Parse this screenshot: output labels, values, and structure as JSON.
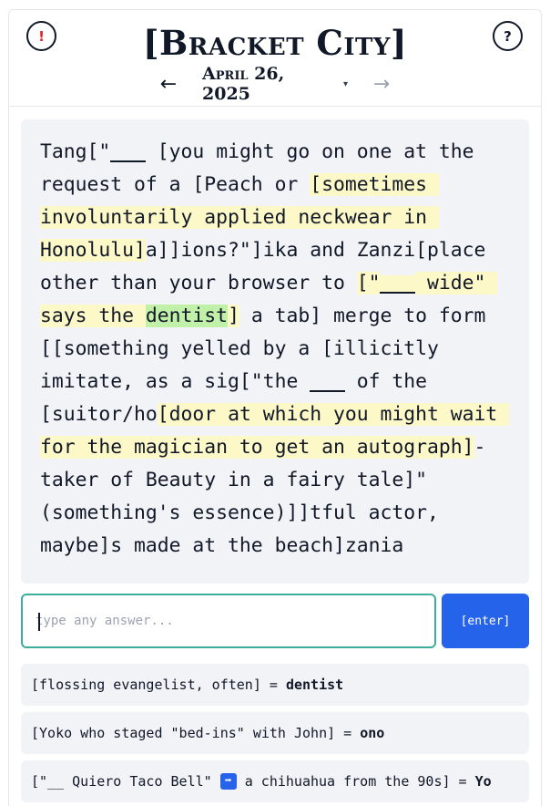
{
  "header": {
    "title": "[Bracket City]",
    "alert_icon_glyph": "!",
    "help_icon_glyph": "?",
    "date": "April 26, 2025",
    "prev_arrow": "←",
    "next_arrow": "→",
    "date_caret": "▾"
  },
  "puzzle": {
    "segments": [
      {
        "text": "Tang[\"",
        "style": ""
      },
      {
        "text": "___",
        "style": "blank"
      },
      {
        "text": " [you might go on one at the request of a [Peach or ",
        "style": ""
      },
      {
        "text": "[sometimes involuntarily applied neckwear in Honolulu]",
        "style": "hl"
      },
      {
        "text": "a]]ions?\"]ika and Zanzi[place other than your browser to ",
        "style": ""
      },
      {
        "text": "[\"",
        "style": "hl"
      },
      {
        "text": "___",
        "style": "hl-blank"
      },
      {
        "text": " wide\" says the ",
        "style": "hl"
      },
      {
        "text": "dentist",
        "style": "solved"
      },
      {
        "text": "]",
        "style": "hl"
      },
      {
        "text": " a tab] merge to form [[something yelled by a [illicitly imitate, as a sig[\"the ",
        "style": ""
      },
      {
        "text": "___",
        "style": "blank"
      },
      {
        "text": " of the [suitor/ho",
        "style": ""
      },
      {
        "text": "[door at which you might wait for the magician to get an autograph]",
        "style": "hl"
      },
      {
        "text": "-taker of Beauty in a fairy tale]\" (something's essence)]]tful actor, maybe]s made at the beach]zania",
        "style": ""
      }
    ]
  },
  "answer_input": {
    "placeholder": "type any answer...",
    "value": ""
  },
  "enter_button": {
    "label": "[enter]"
  },
  "solved_clues": [
    {
      "clue": "[flossing evangelist, often] = ",
      "answer": "dentist"
    },
    {
      "clue": "[Yoko who staged \"bed-ins\" with John] = ",
      "answer": "ono"
    },
    {
      "clue_before": "[\"__ Quiero Taco Bell\" ",
      "icon": "right-arrow-emoji",
      "icon_glyph": "➡",
      "clue_after": " a chihuahua from the 90s] = ",
      "answer": "Yo"
    }
  ],
  "colors": {
    "highlight": "#fdf8c7",
    "solved_highlight": "#c1f0a8",
    "enter_button": "#2563eb",
    "input_border": "#3dae9c",
    "alert": "#dc2626"
  }
}
